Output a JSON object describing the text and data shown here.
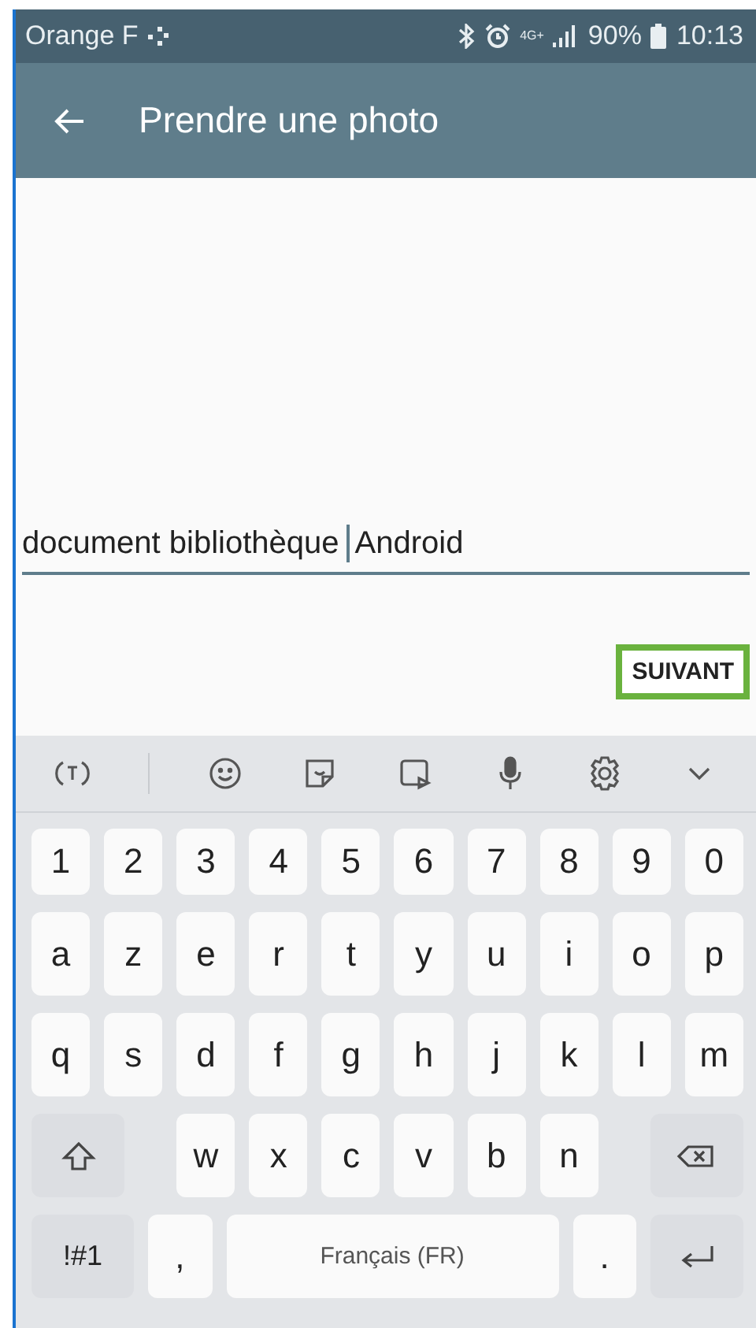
{
  "status_bar": {
    "carrier": "Orange F",
    "network": "4G+",
    "battery": "90%",
    "time": "10:13"
  },
  "app_bar": {
    "title": "Prendre une photo"
  },
  "input": {
    "text_before_cursor": "document bibliothèque",
    "text_after_cursor": "Android"
  },
  "next_button": {
    "label": "SUIVANT",
    "highlighted": true
  },
  "keyboard": {
    "rows": [
      [
        {
          "kind": "char",
          "label": "1"
        },
        {
          "kind": "char",
          "label": "2"
        },
        {
          "kind": "char",
          "label": "3"
        },
        {
          "kind": "char",
          "label": "4"
        },
        {
          "kind": "char",
          "label": "5"
        },
        {
          "kind": "char",
          "label": "6"
        },
        {
          "kind": "char",
          "label": "7"
        },
        {
          "kind": "char",
          "label": "8"
        },
        {
          "kind": "char",
          "label": "9"
        },
        {
          "kind": "char",
          "label": "0"
        }
      ],
      [
        {
          "kind": "char",
          "label": "a"
        },
        {
          "kind": "char",
          "label": "z"
        },
        {
          "kind": "char",
          "label": "e"
        },
        {
          "kind": "char",
          "label": "r"
        },
        {
          "kind": "char",
          "label": "t"
        },
        {
          "kind": "char",
          "label": "y"
        },
        {
          "kind": "char",
          "label": "u"
        },
        {
          "kind": "char",
          "label": "i"
        },
        {
          "kind": "char",
          "label": "o"
        },
        {
          "kind": "char",
          "label": "p"
        }
      ],
      [
        {
          "kind": "char",
          "label": "q"
        },
        {
          "kind": "char",
          "label": "s"
        },
        {
          "kind": "char",
          "label": "d"
        },
        {
          "kind": "char",
          "label": "f"
        },
        {
          "kind": "char",
          "label": "g"
        },
        {
          "kind": "char",
          "label": "h"
        },
        {
          "kind": "char",
          "label": "j"
        },
        {
          "kind": "char",
          "label": "k"
        },
        {
          "kind": "char",
          "label": "l"
        },
        {
          "kind": "char",
          "label": "m"
        }
      ],
      [
        {
          "kind": "shift"
        },
        "",
        {
          "kind": "char",
          "label": "w"
        },
        {
          "kind": "char",
          "label": "x"
        },
        {
          "kind": "char",
          "label": "c"
        },
        {
          "kind": "char",
          "label": "v"
        },
        {
          "kind": "char",
          "label": "b"
        },
        {
          "kind": "char",
          "label": "n"
        },
        "",
        {
          "kind": "backspace"
        }
      ],
      [
        {
          "kind": "symbols",
          "label": "!#1"
        },
        {
          "kind": "char",
          "label": ","
        },
        "",
        "",
        {
          "kind": "space",
          "label": "Français (FR)"
        },
        {
          "kind": "char",
          "label": "."
        },
        {
          "kind": "enter"
        }
      ]
    ]
  }
}
